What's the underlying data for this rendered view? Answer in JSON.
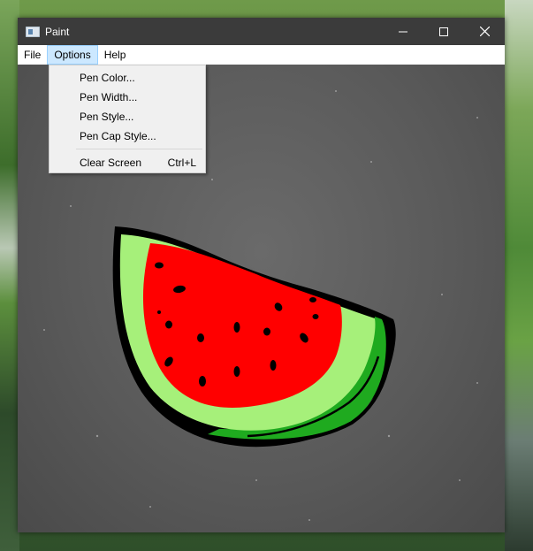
{
  "window": {
    "title": "Paint",
    "controls": [
      "minimize-icon",
      "maximize-icon",
      "close-icon"
    ]
  },
  "menubar": {
    "items": [
      "File",
      "Options",
      "Help"
    ],
    "active": "Options"
  },
  "options_menu": {
    "items": [
      {
        "label": "Pen Color...",
        "shortcut": ""
      },
      {
        "label": "Pen Width...",
        "shortcut": ""
      },
      {
        "label": "Pen Style...",
        "shortcut": ""
      },
      {
        "label": "Pen Cap Style...",
        "shortcut": ""
      },
      {
        "label": "Clear Screen",
        "shortcut": "Ctrl+L"
      }
    ]
  },
  "colors": {
    "rind_outline": "#000000",
    "flesh": "#ff0000",
    "inner_rind": "#a6f07a",
    "outer_rind": "#1faa1f",
    "menu_highlight": "#cce8ff"
  }
}
